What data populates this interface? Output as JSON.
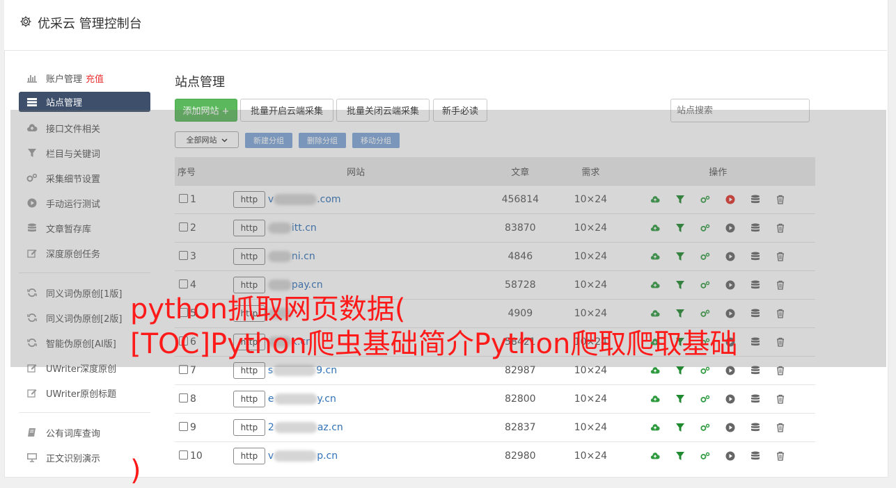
{
  "app": {
    "title": "优采云 管理控制台"
  },
  "sidebar": {
    "items": [
      {
        "label": "账户管理",
        "badge": "充值",
        "icon": "bar-chart-icon"
      },
      {
        "label": "站点管理",
        "icon": "server-icon",
        "active": true
      },
      {
        "label": "接口文件相关",
        "icon": "cloud-upload-icon"
      },
      {
        "label": "栏目与关键词",
        "icon": "filter-icon"
      },
      {
        "label": "采集细节设置",
        "icon": "gears-icon"
      },
      {
        "label": "手动运行测试",
        "icon": "play-circle-icon"
      },
      {
        "label": "文章暂存库",
        "icon": "database-icon"
      },
      {
        "label": "深度原创任务",
        "icon": "edit-icon"
      }
    ],
    "items2": [
      {
        "label": "同义词伪原创[1版]",
        "icon": "refresh-icon"
      },
      {
        "label": "同义词伪原创[2版]",
        "icon": "refresh-icon"
      },
      {
        "label": "智能伪原创[AI版]",
        "icon": "refresh-icon"
      },
      {
        "label": "UWriter深度原创",
        "icon": "edit-icon"
      },
      {
        "label": "UWriter原创标题",
        "icon": "edit-icon"
      }
    ],
    "items3": [
      {
        "label": "公有词库查询",
        "icon": "book-icon"
      },
      {
        "label": "正文识别演示",
        "icon": "monitor-icon"
      }
    ]
  },
  "main": {
    "title": "站点管理",
    "toolbar": {
      "add_site": "添加网站 +",
      "batch_open": "批量开启云端采集",
      "batch_close": "批量关闭云端采集",
      "newbie": "新手必读",
      "search_placeholder": "站点搜索"
    },
    "group_select": "全部网站",
    "group_buttons": {
      "new": "新建分组",
      "delete": "删除分组",
      "move": "移动分组"
    },
    "table": {
      "headers": {
        "seq": "序号",
        "site": "网站",
        "articles": "文章",
        "demand": "需求",
        "ops": "操作"
      },
      "rows": [
        {
          "seq": "1",
          "protocol": "http",
          "site_prefix": "v",
          "site": ".com",
          "articles": "456814",
          "demand": "10×24",
          "play_active": true
        },
        {
          "seq": "2",
          "protocol": "http",
          "site_prefix": "",
          "site": "itt.cn",
          "articles": "83870",
          "demand": "10×24"
        },
        {
          "seq": "3",
          "protocol": "http",
          "site_prefix": "",
          "site": "ni.cn",
          "articles": "4846",
          "demand": "10×24"
        },
        {
          "seq": "4",
          "protocol": "http",
          "site_prefix": "",
          "site": "pay.cn",
          "articles": "58728",
          "demand": "10×24"
        },
        {
          "seq": "5",
          "protocol": "http",
          "site_prefix": "",
          "site": "",
          "articles": "4909",
          "demand": "10×24"
        },
        {
          "seq": "6",
          "protocol": "http",
          "site_prefix": "",
          "site": "k.cn",
          "articles": "58421",
          "demand": "10×24"
        },
        {
          "seq": "7",
          "protocol": "http",
          "site_prefix": "s",
          "site": "9.cn",
          "articles": "82987",
          "demand": "10×24"
        },
        {
          "seq": "8",
          "protocol": "http",
          "site_prefix": "e",
          "site": "y.cn",
          "articles": "82800",
          "demand": "10×24"
        },
        {
          "seq": "9",
          "protocol": "http",
          "site_prefix": "2",
          "site": "az.cn",
          "articles": "82837",
          "demand": "10×24"
        },
        {
          "seq": "10",
          "protocol": "http",
          "site_prefix": "v",
          "site": "p.cn",
          "articles": "82980",
          "demand": "10×24"
        }
      ]
    }
  },
  "overlay": {
    "caption_line1": "python抓取网页数据(",
    "caption_line2": "[TOC]Python爬虫基础简介Python爬取爬取基础",
    "caption_tail": ")"
  },
  "colors": {
    "accent_green": "#5cb85c",
    "sidebar_active": "#3d4f6b",
    "link": "#3071b8",
    "caption": "#ff1a1a"
  }
}
